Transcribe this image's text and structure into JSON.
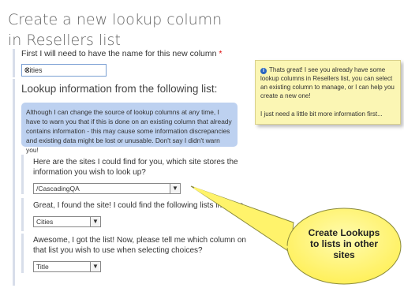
{
  "page": {
    "title_line1": "Create a new lookup column",
    "title_line2": "in Resellers list"
  },
  "name_field": {
    "label": "First I will need to have the name for this new column",
    "required_mark": "*",
    "value": "Cities",
    "clear_glyph": "✕"
  },
  "lookup": {
    "heading": "Lookup information from the following list:",
    "warning": "Although I can change the source of lookup columns at any time, I have to warn you that if this is done on an existing column that already contains information - this may cause some information discrepancies and existing data might be lost or unusable. Don't say I didn't warn you!",
    "site_question_line1": "Here are the sites I could find for you, which site stores the",
    "site_question_line2": "information you wish to look up?",
    "site_value": "/CascadingQA",
    "list_question": "Great, I found the site! I could find the following lists in that site",
    "list_value": "Cities",
    "column_question_line1": "Awesome, I got the list! Now, please tell me which column on",
    "column_question_line2": "that list you wish to use when selecting choices?",
    "column_value": "Title"
  },
  "note": {
    "icon": "info-icon",
    "message": "Thats great! I see you already have some lookup columns in Resellers list, you can select an existing column to manage, or I can help you create a new one!",
    "followup": "I just need a little bit more information first..."
  },
  "callout": {
    "line1": "Create Lookups",
    "line2": "to lists in other",
    "line3": "sites"
  },
  "colors": {
    "warning_bg": "#bdd1f0",
    "note_bg": "#fbf6b4",
    "callout_bg": "#fff36b",
    "accent_bar": "#d8deea"
  }
}
